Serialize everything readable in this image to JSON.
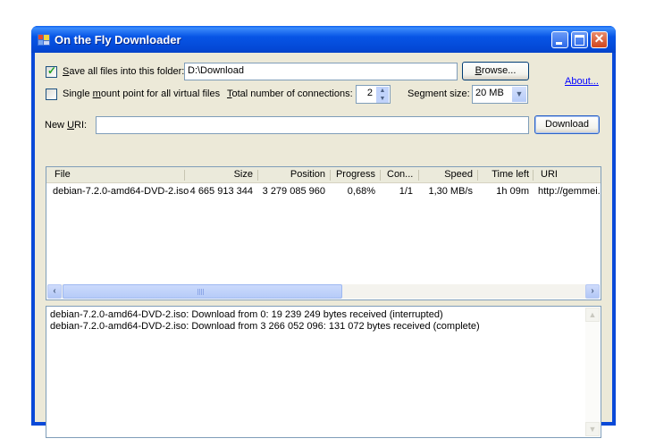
{
  "window": {
    "title": "On the Fly Downloader",
    "icon": "app-icon",
    "controls": {
      "minimize": "minimize-icon",
      "maximize": "maximize-icon",
      "close": "close-icon"
    }
  },
  "settings": {
    "save_all_checked": true,
    "save_all_label_prefix": "",
    "save_all_label_accel": "S",
    "save_all_label_rest": "ave all files into this folder:",
    "folder_value": "D:\\Download",
    "browse_accel": "B",
    "browse_rest": "rowse...",
    "about_label": "About...",
    "single_mount_checked": false,
    "single_mount_pre": "Single ",
    "single_mount_accel": "m",
    "single_mount_rest": "ount point for all virtual files",
    "connections_accel": "T",
    "connections_rest": "otal number of connections:",
    "connections_value": "2",
    "segment_pre": "Se",
    "segment_accel": "g",
    "segment_rest": "ment size:",
    "segment_value": "20 MB"
  },
  "new_uri": {
    "label_pre": "New ",
    "label_accel": "U",
    "label_rest": "RI:",
    "value": "",
    "download_label": "Download"
  },
  "downloads": {
    "columns": [
      "File",
      "Size",
      "Position",
      "Progress",
      "Con...",
      "Speed",
      "Time left",
      "URI"
    ],
    "rows": [
      {
        "file": "debian-7.2.0-amd64-DVD-2.iso",
        "size": "4 665 913 344",
        "position": "3 279 085 960",
        "progress": "0,68%",
        "connections": "1/1",
        "speed": "1,30 MB/s",
        "time_left": "1h 09m",
        "uri": "http://gemmei."
      }
    ]
  },
  "log": {
    "lines": [
      "debian-7.2.0-amd64-DVD-2.iso: Download from 0: 19 239 249 bytes received (interrupted)",
      "debian-7.2.0-amd64-DVD-2.iso: Download from 3 266 052 096: 131 072 bytes received (complete)"
    ]
  }
}
